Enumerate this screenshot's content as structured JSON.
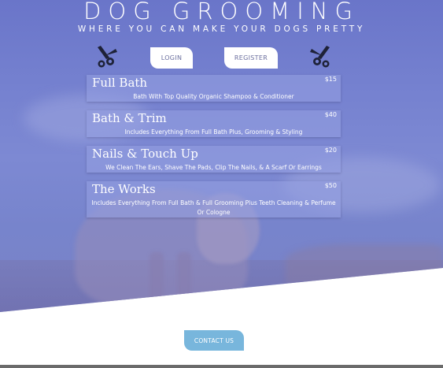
{
  "header": {
    "title": "DOG GROOMING",
    "tagline": "WHERE YOU CAN MAKE YOUR DOGS PRETTY"
  },
  "nav": {
    "login_label": "LOGIN",
    "register_label": "REGISTER",
    "icons": [
      "scissors-icon",
      "scissors-icon"
    ]
  },
  "services": [
    {
      "name": "Full Bath",
      "price": "$15",
      "description": "Bath With Top Quality Organic Shampoo & Conditioner"
    },
    {
      "name": "Bath & Trim",
      "price": "$40",
      "description": "Includes Everything From Full Bath Plus, Grooming & Styling"
    },
    {
      "name": "Nails & Touch Up",
      "price": "$20",
      "description": "We Clean The Ears, Shave The Pads, Clip The Nails, & A Scarf Or Earrings"
    },
    {
      "name": "The Works",
      "price": "$50",
      "description": "Includes Everything From Full Bath & Full Grooming Plus Teeth Cleaning & Perfume Or Cologne"
    }
  ],
  "footer": {
    "contact_label": "CONTACT US"
  },
  "colors": {
    "hero_overlay": "#7480cf",
    "contact_button": "#78b6dc",
    "icon_color": "#1e2238"
  }
}
